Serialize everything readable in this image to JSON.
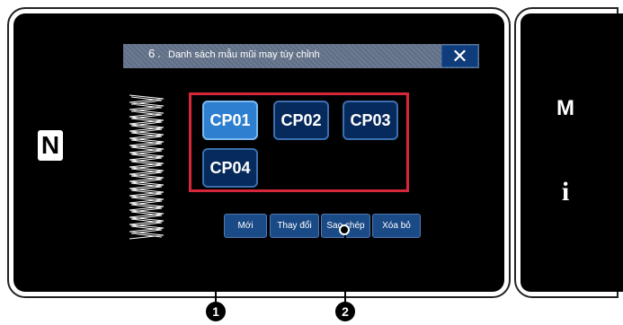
{
  "dialog": {
    "title_number": "6",
    "title": "Danh sách mẫu mũi may tùy chỉnh",
    "close_label": "✕"
  },
  "patterns": [
    {
      "label": "CP01",
      "selected": true
    },
    {
      "label": "CP02",
      "selected": false
    },
    {
      "label": "CP03",
      "selected": false
    },
    {
      "label": "CP04",
      "selected": false
    }
  ],
  "actions": {
    "new": "Mới",
    "change": "Thay đổi",
    "copy": "Sao chép",
    "delete": "Xóa bỏ"
  },
  "side": {
    "mode_label": "M",
    "info_label": "i"
  },
  "nfc_icon": "nfc-icon",
  "callouts": [
    "1",
    "2"
  ],
  "colors": {
    "screen_bg": "#000000",
    "titlebar": "#66758b",
    "button_bg": "#062a5c",
    "button_selected": "#2e7fd0",
    "highlight_border": "#d6273a"
  }
}
